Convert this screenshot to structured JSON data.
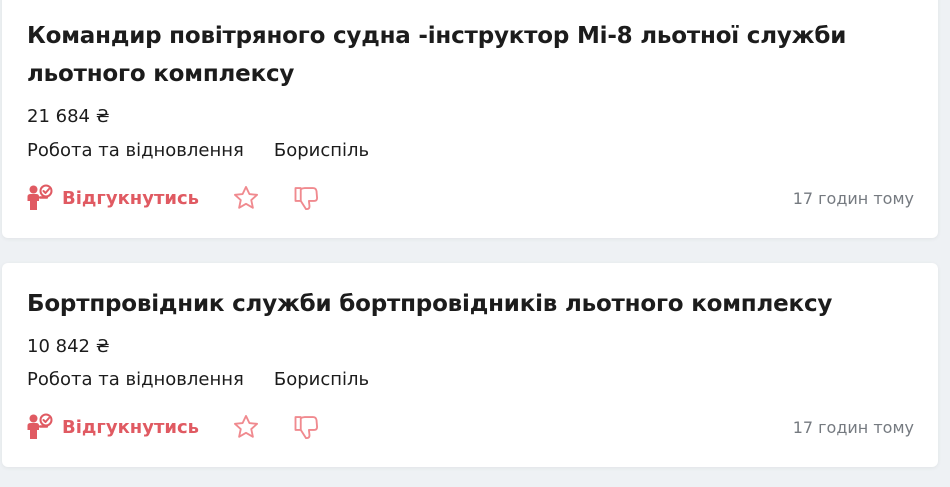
{
  "colors": {
    "accent": "#e05a62",
    "accent_light": "#f08a8f",
    "text": "#1c1c1c",
    "muted": "#757a80",
    "page_bg": "#eef1f4"
  },
  "icons": {
    "apply": "person-check-icon",
    "favorite": "star-icon",
    "dislike": "thumbs-down-icon"
  },
  "vacancies": [
    {
      "title": "Командир повітряного судна -інструктор Мі-8 льотної служби льотного комплексу",
      "salary": "21 684 ₴",
      "category": "Робота та відновлення",
      "city": "Бориспіль",
      "apply_label": "Відгукнутись",
      "posted": "17 годин тому"
    },
    {
      "title": "Бортпровідник служби бортпровідників льотного комплексу",
      "salary": "10 842 ₴",
      "category": "Робота та відновлення",
      "city": "Бориспіль",
      "apply_label": "Відгукнутись",
      "posted": "17 годин тому"
    }
  ]
}
